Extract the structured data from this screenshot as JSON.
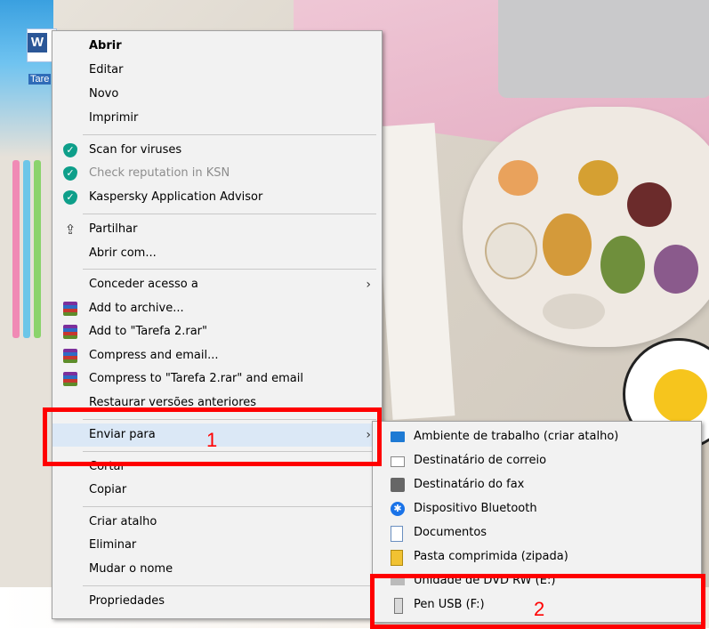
{
  "desktop": {
    "file_icon_letter": "W",
    "file_label": "Tare"
  },
  "context_menu": {
    "items": [
      {
        "label": "Abrir"
      },
      {
        "label": "Editar"
      },
      {
        "label": "Novo"
      },
      {
        "label": "Imprimir"
      },
      {
        "label": "Scan for viruses",
        "icon": "kaspersky-shield-icon"
      },
      {
        "label": "Check reputation in KSN",
        "icon": "kaspersky-shield-icon"
      },
      {
        "label": "Kaspersky Application Advisor",
        "icon": "kaspersky-shield-icon"
      },
      {
        "label": "Partilhar",
        "icon": "share-icon"
      },
      {
        "label": "Abrir com..."
      },
      {
        "label": "Conceder acesso a"
      },
      {
        "label": "Add to archive...",
        "icon": "winrar-icon"
      },
      {
        "label": "Add to \"Tarefa 2.rar\"",
        "icon": "winrar-icon"
      },
      {
        "label": "Compress and email...",
        "icon": "winrar-icon"
      },
      {
        "label": "Compress to \"Tarefa 2.rar\" and email",
        "icon": "winrar-icon"
      },
      {
        "label": "Restaurar versões anteriores"
      },
      {
        "label": "Enviar para"
      },
      {
        "label": "Cortar"
      },
      {
        "label": "Copiar"
      },
      {
        "label": "Criar atalho"
      },
      {
        "label": "Eliminar"
      },
      {
        "label": "Mudar o nome"
      },
      {
        "label": "Propriedades"
      }
    ],
    "submenu_arrow": "›"
  },
  "send_to_menu": {
    "items": [
      {
        "label": "Ambiente de trabalho (criar atalho)",
        "icon": "desktop-icon"
      },
      {
        "label": "Destinatário de correio",
        "icon": "mail-icon"
      },
      {
        "label": "Destinatário do fax",
        "icon": "fax-icon"
      },
      {
        "label": "Dispositivo Bluetooth",
        "icon": "bluetooth-icon"
      },
      {
        "label": "Documentos",
        "icon": "documents-icon"
      },
      {
        "label": "Pasta comprimida (zipada)",
        "icon": "zip-folder-icon"
      },
      {
        "label": "Unidade de DVD RW (E:)",
        "icon": "dvd-drive-icon"
      },
      {
        "label": "Pen USB (F:)",
        "icon": "usb-drive-icon"
      }
    ]
  },
  "annotations": {
    "step1": "1",
    "step2": "2",
    "color": "#ff0000"
  }
}
